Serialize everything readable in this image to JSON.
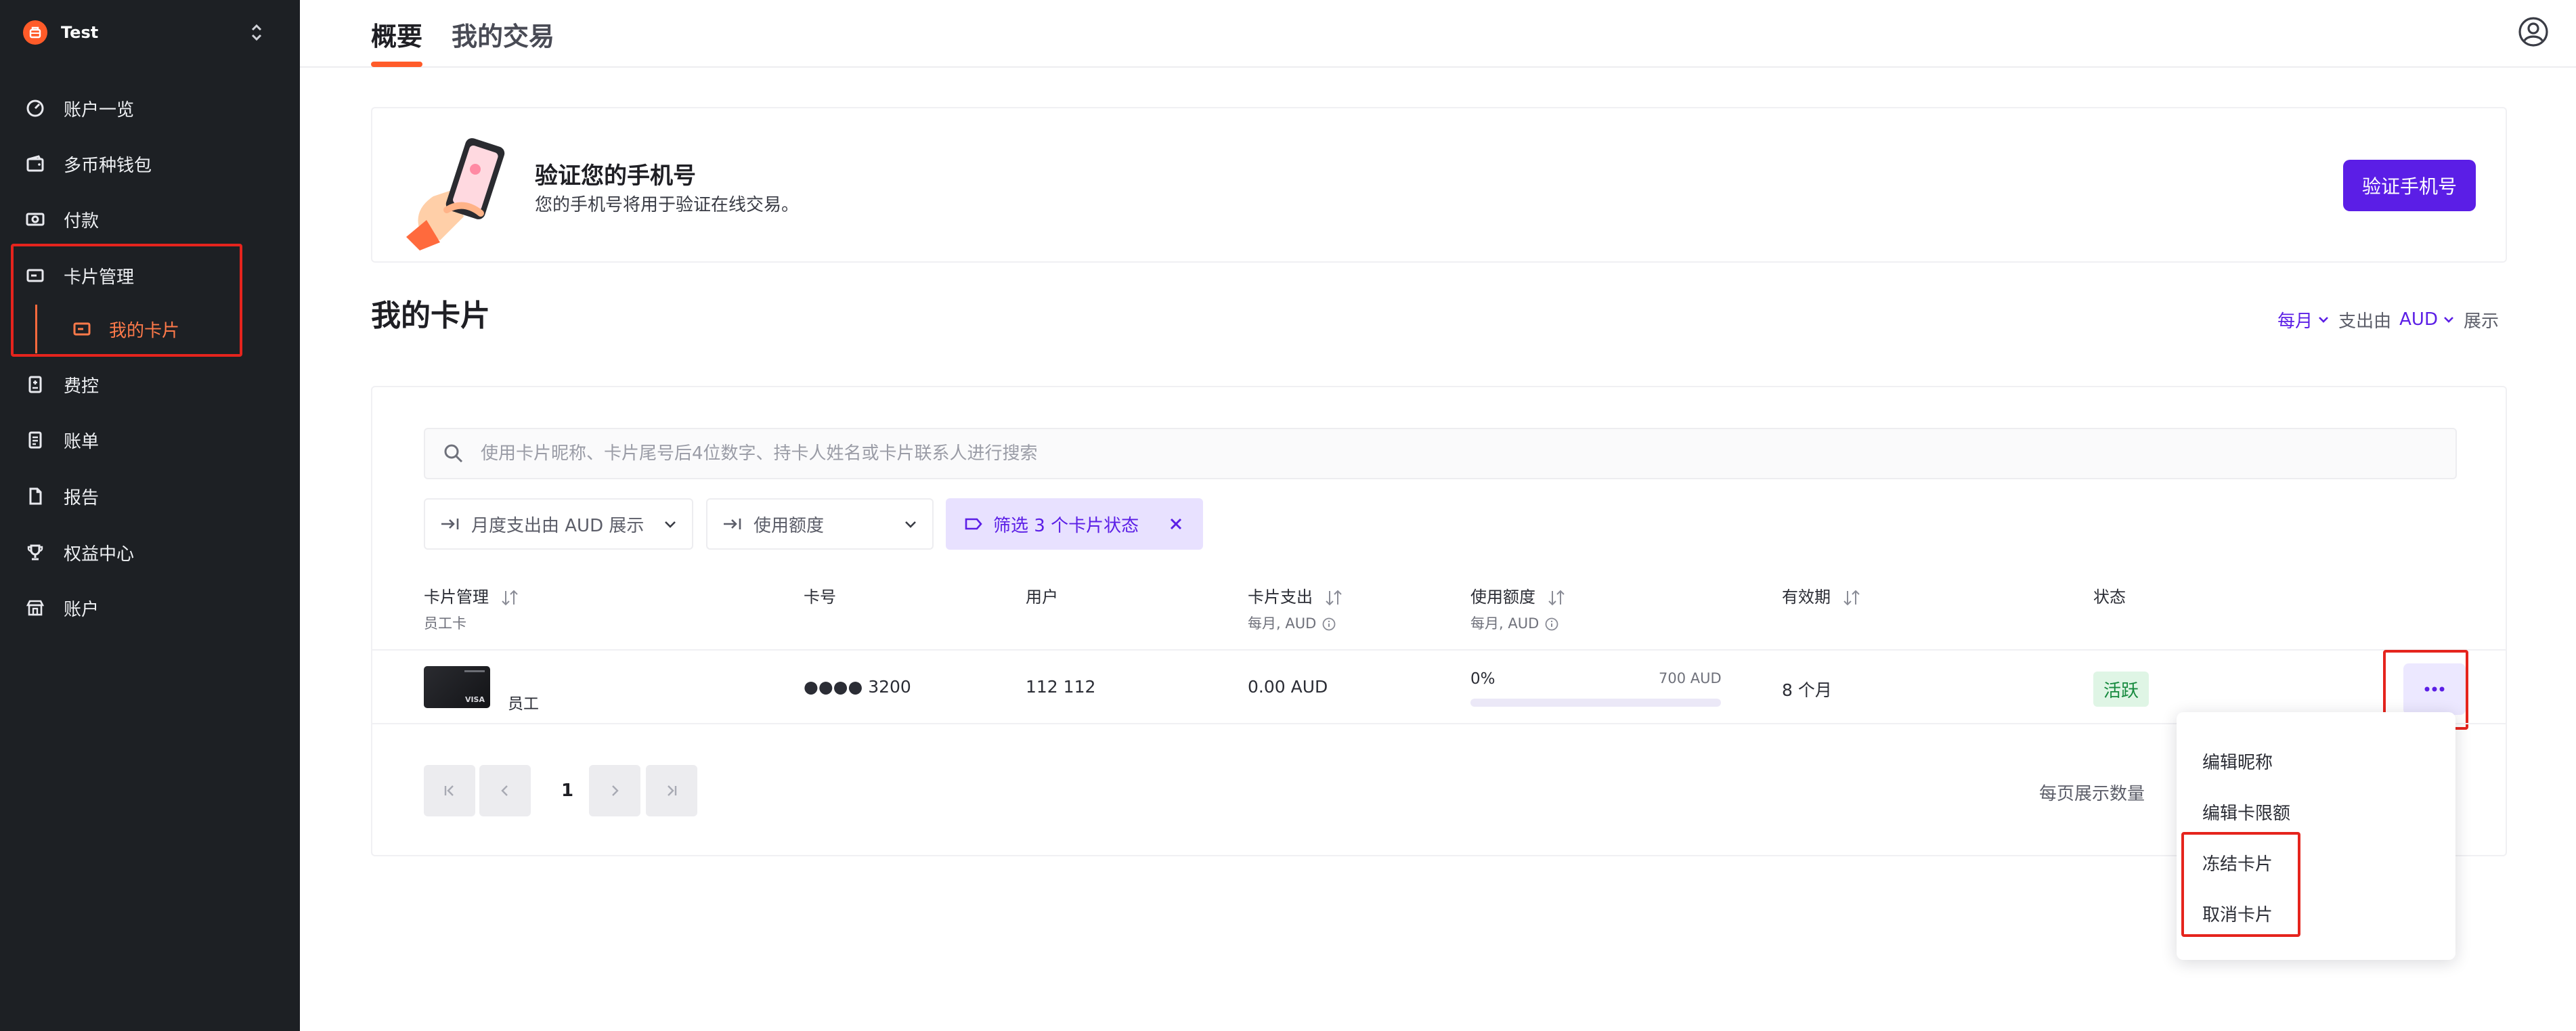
{
  "sidebar": {
    "org_name": "Test",
    "items": [
      {
        "label": "账户一览",
        "icon": "dashboard-icon"
      },
      {
        "label": "多币种钱包",
        "icon": "wallet-icon"
      },
      {
        "label": "付款",
        "icon": "payment-icon"
      },
      {
        "label": "卡片管理",
        "icon": "card-icon"
      },
      {
        "label": "我的卡片",
        "icon": "card-icon"
      },
      {
        "label": "费控",
        "icon": "expense-icon"
      },
      {
        "label": "账单",
        "icon": "bill-icon"
      },
      {
        "label": "报告",
        "icon": "report-icon"
      },
      {
        "label": "权益中心",
        "icon": "trophy-icon"
      },
      {
        "label": "账户",
        "icon": "store-icon"
      }
    ]
  },
  "tabs": {
    "overview": "概要",
    "transactions": "我的交易"
  },
  "banner": {
    "title": "验证您的手机号",
    "description": "您的手机号将用于验证在线交易。",
    "button": "验证手机号"
  },
  "section": {
    "title": "我的卡片",
    "period": "每月",
    "spend_from": "支出由",
    "currency": "AUD",
    "display": "展示"
  },
  "search": {
    "placeholder": "使用卡片昵称、卡片尾号后4位数字、持卡人姓名或卡片联系人进行搜索"
  },
  "filters": {
    "spend_display": "月度支出由 AUD 展示",
    "usage_limit": "使用额度",
    "status": "筛选 3 个卡片状态"
  },
  "table": {
    "headers": {
      "card": "卡片管理",
      "card_sub": "员工卡",
      "number": "卡号",
      "user": "用户",
      "spend": "卡片支出",
      "spend_sub": "每月, AUD",
      "usage": "使用额度",
      "usage_sub": "每月, AUD",
      "expiry": "有效期",
      "status": "状态"
    },
    "rows": [
      {
        "card_type": "员工",
        "number": "●●●● 3200",
        "user": "112 112",
        "spend": "0.00 AUD",
        "usage_percent": "0%",
        "usage_value": 0,
        "usage_limit": "700 AUD",
        "expiry": "8 个月",
        "status": "活跃"
      }
    ]
  },
  "pagination": {
    "current_page": "1",
    "per_page_label": "每页展示数量"
  },
  "menu": {
    "items": [
      "编辑昵称",
      "编辑卡限额",
      "冻结卡片",
      "取消卡片"
    ]
  },
  "colors": {
    "accent": "#5b1ee6",
    "brand": "#ff5b29",
    "highlight": "#e5241d",
    "sidebar_bg": "#1d2024"
  }
}
